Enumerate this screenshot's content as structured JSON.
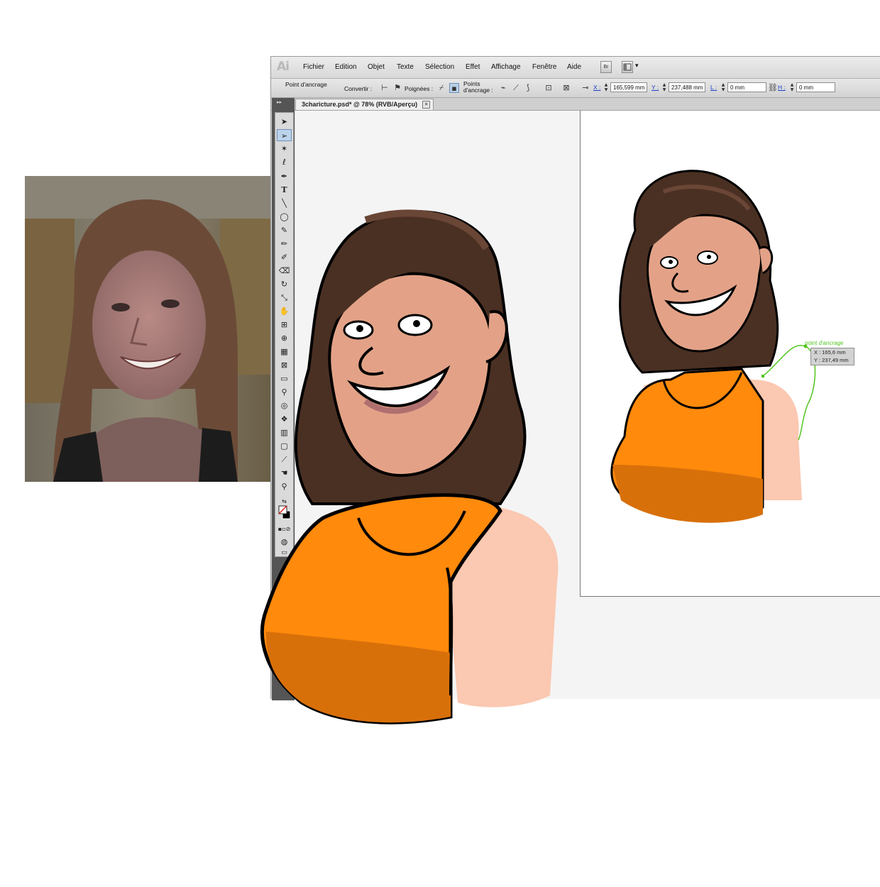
{
  "app": {
    "logo": "Ai",
    "menu": [
      "Fichier",
      "Edition",
      "Objet",
      "Texte",
      "Sélection",
      "Effet",
      "Affichage",
      "Fenêtre",
      "Aide"
    ],
    "bridge_button": "Br",
    "workspace_arrow": "▾"
  },
  "control_bar": {
    "tool_name": "Point d'ancrage",
    "convert_label": "Convertir :",
    "handles_label": "Poignées :",
    "anchor_points_label_line1": "Points",
    "anchor_points_label_line2": "d'ancrage :",
    "x_label": "X :",
    "x_value": "165,599 mm",
    "y_label": "Y :",
    "y_value": "237,488 mm",
    "w_label": "L :",
    "w_value": "0 mm",
    "h_label": "H :",
    "h_value": "0 mm"
  },
  "document": {
    "tab_title": "3charicture.psd* @ 78% (RVB/Aperçu)",
    "close_glyph": "×",
    "panel_collapse": "▸▸"
  },
  "tooltip": {
    "title": "point d'ancrage",
    "x_line": "X : 165,6 mm",
    "y_line": "Y : 237,49 mm"
  },
  "colors": {
    "orange_top": "#ff8a0c",
    "orange_shadow": "#d8700a",
    "skin": "#e3a287",
    "skin_light": "#fbc8b1",
    "hair": "#4a3023",
    "hair_highlight": "#6a4636",
    "path_green": "#52c51f"
  },
  "icons": {
    "selection": "selection-arrow-icon",
    "direct_selection": "direct-selection-icon",
    "pen": "pen-icon",
    "type": "type-icon"
  }
}
